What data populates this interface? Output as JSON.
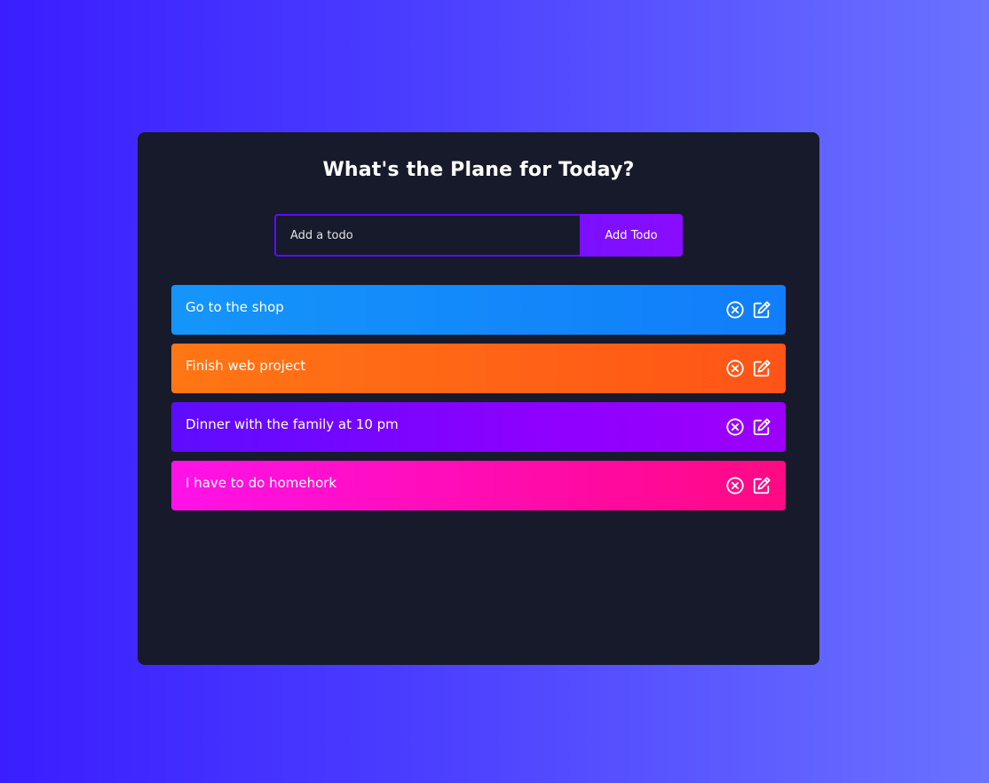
{
  "app": {
    "title": "What's the Plane for Today?"
  },
  "form": {
    "placeholder": "Add a todo",
    "value": "",
    "button_label": "Add Todo"
  },
  "todos": [
    {
      "text": "Go to the shop",
      "color": "#1595fa"
    },
    {
      "text": "Finish web project",
      "color": "#ff7614"
    },
    {
      "text": "Dinner with the family at 10 pm",
      "color": "#5d0cff"
    },
    {
      "text": "I have to do homehork",
      "color": "#ff12e8"
    }
  ],
  "icons": {
    "delete": "close-circle-icon",
    "edit": "edit-icon"
  },
  "colors": {
    "accent": "#5d0cff",
    "panel": "#161a2b"
  }
}
